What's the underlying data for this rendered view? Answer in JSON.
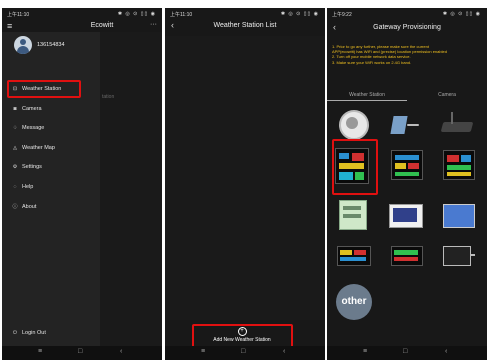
{
  "panel1": {
    "status_time": "上午11:10",
    "status_icons": "✱ ◎ ⊙ ▯▯ ◉",
    "title": "Ecowitt",
    "menu_icon": "hamburger-icon",
    "more": "···",
    "username": "136154834",
    "behind_text": "tation",
    "menu": [
      {
        "label": "Weather Station",
        "icon": "station-icon",
        "glyph": "⊡"
      },
      {
        "label": "Camera",
        "icon": "camera-icon",
        "glyph": "◙"
      },
      {
        "label": "Message",
        "icon": "bell-icon",
        "glyph": "♢"
      },
      {
        "label": "Weather Map",
        "icon": "map-icon",
        "glyph": "◬"
      },
      {
        "label": "Settings",
        "icon": "gear-icon",
        "glyph": "⚙"
      },
      {
        "label": "Help",
        "icon": "help-icon",
        "glyph": "◌"
      },
      {
        "label": "About",
        "icon": "info-icon",
        "glyph": "ⓘ"
      }
    ],
    "logout": "Login Out"
  },
  "panel2": {
    "status_time": "上午11:10",
    "status_icons": "✱ ◎ ⊙ ▯▯ ◉",
    "title": "Weather Station List",
    "add_label": "Add New Weather Station"
  },
  "panel3": {
    "status_time": "上午9:22",
    "status_icons": "✱ ◎ ⊙ ▯▯ ◉",
    "title": "Gateway Provisioning",
    "instructions": [
      "1. Prior to go any further, please make sure the current",
      "APP(ecowitt) has WiFi and (precise) location permission enabled",
      "2. Turn off your mobile network data service.",
      "3. Make sure your WiFi works on 2.4G band."
    ],
    "tabs": [
      "Weather Station",
      "Camera"
    ],
    "other_label": "other"
  },
  "nav_glyphs": [
    "≡",
    "□",
    "‹"
  ],
  "colors": {
    "highlight": "#e01010",
    "instruction_text": "#f0c020",
    "background": "#181818"
  }
}
